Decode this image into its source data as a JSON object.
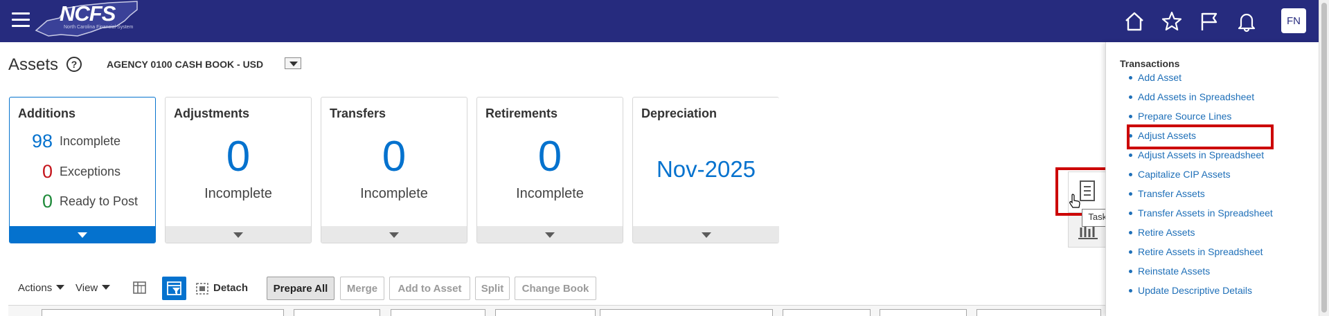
{
  "header": {
    "logo_text": "NCFS",
    "logo_subtext": "North Carolina Financial System",
    "avatar_initials": "FN",
    "icons": [
      "home-icon",
      "star-icon",
      "flag-icon",
      "bell-icon"
    ]
  },
  "page": {
    "title": "Assets",
    "book": "AGENCY 0100 CASH BOOK - USD"
  },
  "tiles": {
    "additions": {
      "title": "Additions",
      "metrics": [
        {
          "value": "98",
          "label": "Incomplete",
          "color": "#0572ce"
        },
        {
          "value": "0",
          "label": "Exceptions",
          "color": "#c4141b"
        },
        {
          "value": "0",
          "label": "Ready to Post",
          "color": "#1f8a3a"
        }
      ]
    },
    "adjustments": {
      "title": "Adjustments",
      "value": "0",
      "label": "Incomplete"
    },
    "transfers": {
      "title": "Transfers",
      "value": "0",
      "label": "Incomplete"
    },
    "retirements": {
      "title": "Retirements",
      "value": "0",
      "label": "Incomplete"
    },
    "depreciation": {
      "title": "Depreciation",
      "period": "Nov-2025"
    }
  },
  "toolbar": {
    "actions_label": "Actions",
    "view_label": "View",
    "detach_label": "Detach",
    "prepare_all": "Prepare All",
    "merge": "Merge",
    "add_to_asset": "Add to Asset",
    "split": "Split",
    "change_book": "Change Book"
  },
  "tooltip": "Tasks",
  "tasks": {
    "heading": "Transactions",
    "items": [
      "Add Asset",
      "Add Assets in Spreadsheet",
      "Prepare Source Lines",
      "Adjust Assets",
      "Adjust Assets in Spreadsheet",
      "Capitalize CIP Assets",
      "Transfer Assets",
      "Transfer Assets in Spreadsheet",
      "Retire Assets",
      "Retire Assets in Spreadsheet",
      "Reinstate Assets",
      "Update Descriptive Details"
    ]
  },
  "colors": {
    "header_bg": "#262b7e",
    "accent": "#0572ce",
    "link": "#1e6fb8",
    "highlight": "#cc0000"
  }
}
